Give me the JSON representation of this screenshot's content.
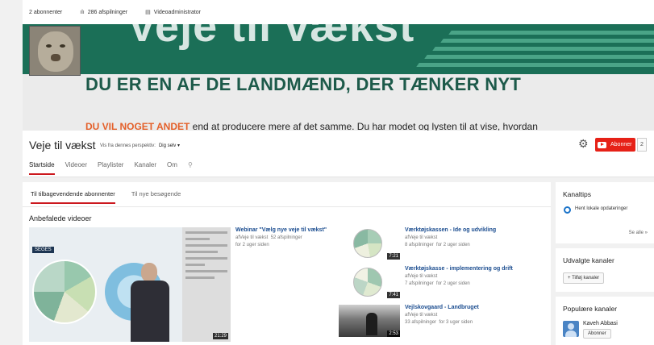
{
  "stats": {
    "subscribers": "2 abonnenter",
    "views": "286 afspilninger",
    "video_manager": "Videoadministrator"
  },
  "banner": {
    "big_text": "Veje til vækst",
    "headline": "DU ER EN AF DE LANDMÆND, DER TÆNKER NYT",
    "subline_accent": "DU VIL NOGET ANDET",
    "subline_rest": " end at producere mere af det samme. Du har modet og lysten til at vise, hvordan"
  },
  "channel": {
    "title": "Veje til vækst",
    "perspective_label": "Vis fra dennes perspektiv:",
    "perspective_value": "Dig selv ▾",
    "subscribe_label": "Abonner",
    "subscribe_count": "2",
    "tabs": [
      "Startside",
      "Videoer",
      "Playlister",
      "Kanaler",
      "Om"
    ]
  },
  "main": {
    "subtabs": [
      "Til tilbagevendende abonnenter",
      "Til nye besøgende"
    ],
    "section_title": "Anbefalede videoer",
    "featured": {
      "slide_logo": "SEGES",
      "duration": "21:29",
      "title": "Webinar \"Vælg nye veje til vækst\"",
      "channel": "afVeje til vækst",
      "views": "52 afspilninger",
      "age": "for 2 uger siden"
    },
    "videos": [
      {
        "title": "Værktøjskassen - Ide og udvikling",
        "channel": "afVeje til vækst",
        "views": "8 afspilninger",
        "age": "for 2 uger siden",
        "duration": "7:21"
      },
      {
        "title": "Værktøjskasse - implementering og drift",
        "channel": "afVeje til vækst",
        "views": "7 afspilninger",
        "age": "for 2 uger siden",
        "duration": "7:41"
      },
      {
        "title": "Vejlskovgaard - Landbruget",
        "channel": "afVeje til vækst",
        "views": "33 afspilninger",
        "age": "for 3 uger siden",
        "duration": "2:53"
      }
    ]
  },
  "sidebar": {
    "tips_title": "Kanaltips",
    "tips_item": "Hent lokale opdateringer",
    "see_all": "Se alle »",
    "featured_title": "Udvalgte kanaler",
    "add_channels": "+ Tilføj kanaler",
    "popular_title": "Populære kanaler",
    "popular_name": "Kaveh Abbasi",
    "popular_button": "Abonner"
  },
  "colors": {
    "banner_green": "#1b6f57",
    "headline_green": "#1d5a4a",
    "accent_orange": "#e4602a",
    "youtube_red": "#e62117",
    "link_blue": "#1a4c8f"
  }
}
